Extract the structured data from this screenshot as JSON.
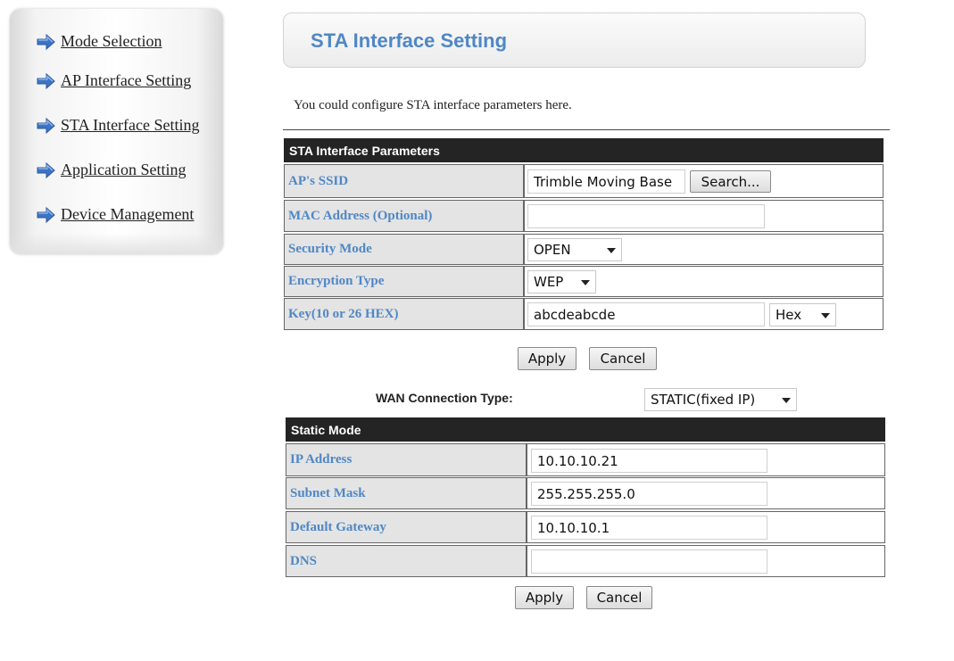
{
  "sidebar": {
    "items": [
      {
        "label": "Mode Selection"
      },
      {
        "label": "AP Interface Setting"
      },
      {
        "label": "STA Interface Setting"
      },
      {
        "label": "Application Setting"
      },
      {
        "label": "Device Management"
      }
    ],
    "icon": "arrow-right-icon"
  },
  "header": {
    "title": "STA Interface Setting"
  },
  "description": "You could configure STA interface parameters here.",
  "sta_params": {
    "title": "STA Interface Parameters",
    "ssid_label": "AP's SSID",
    "ssid_value": "Trimble Moving Base",
    "search_label": "Search...",
    "mac_label": "MAC Address (Optional)",
    "mac_value": "",
    "security_label": "Security Mode",
    "security_value": "OPEN",
    "encryption_label": "Encryption Type",
    "encryption_value": "WEP",
    "key_label": "Key(10 or 26 HEX)",
    "key_value": "abcdeabcde",
    "key_format": "Hex",
    "apply_label": "Apply",
    "cancel_label": "Cancel"
  },
  "wan": {
    "label": "WAN Connection Type:",
    "value": "STATIC(fixed IP)"
  },
  "static_mode": {
    "title": "Static Mode",
    "ip_label": "IP Address",
    "ip_value": "10.10.10.21",
    "subnet_label": "Subnet Mask",
    "subnet_value": "255.255.255.0",
    "gateway_label": "Default Gateway",
    "gateway_value": "10.10.10.1",
    "dns_label": "DNS",
    "dns_value": "",
    "apply_label": "Apply",
    "cancel_label": "Cancel"
  },
  "colors": {
    "accent": "#4f87c5",
    "table_header": "#242424",
    "label_bg": "#e4e4e4"
  }
}
